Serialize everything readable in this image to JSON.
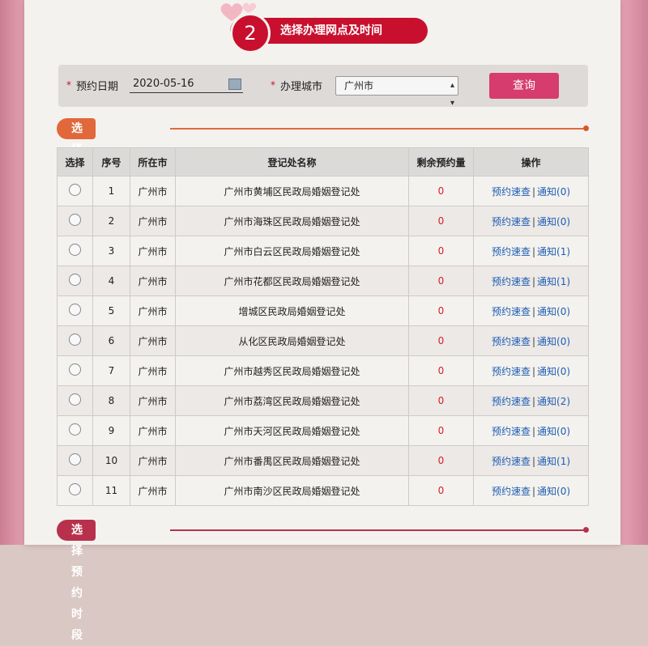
{
  "step": {
    "number": "2",
    "title": "选择办理网点及时间"
  },
  "search": {
    "date_label": "预约日期",
    "date_value": "2020-05-16",
    "city_label": "办理城市",
    "city_value": "广州市",
    "query_label": "查询"
  },
  "section_office": "选择办理网点",
  "section_time": "选择预约时段",
  "table": {
    "headers": [
      "选择",
      "序号",
      "所在市",
      "登记处名称",
      "剩余预约量",
      "操作"
    ],
    "rows": [
      {
        "no": "1",
        "city": "广州市",
        "name": "广州市黄埔区民政局婚姻登记处",
        "remain": "0",
        "query": "预约速查",
        "notify": "通知(0)"
      },
      {
        "no": "2",
        "city": "广州市",
        "name": "广州市海珠区民政局婚姻登记处",
        "remain": "0",
        "query": "预约速查",
        "notify": "通知(0)"
      },
      {
        "no": "3",
        "city": "广州市",
        "name": "广州市白云区民政局婚姻登记处",
        "remain": "0",
        "query": "预约速查",
        "notify": "通知(1)"
      },
      {
        "no": "4",
        "city": "广州市",
        "name": "广州市花都区民政局婚姻登记处",
        "remain": "0",
        "query": "预约速查",
        "notify": "通知(1)"
      },
      {
        "no": "5",
        "city": "广州市",
        "name": "增城区民政局婚姻登记处",
        "remain": "0",
        "query": "预约速查",
        "notify": "通知(0)"
      },
      {
        "no": "6",
        "city": "广州市",
        "name": "从化区民政局婚姻登记处",
        "remain": "0",
        "query": "预约速查",
        "notify": "通知(0)"
      },
      {
        "no": "7",
        "city": "广州市",
        "name": "广州市越秀区民政局婚姻登记处",
        "remain": "0",
        "query": "预约速查",
        "notify": "通知(0)"
      },
      {
        "no": "8",
        "city": "广州市",
        "name": "广州市荔湾区民政局婚姻登记处",
        "remain": "0",
        "query": "预约速查",
        "notify": "通知(2)"
      },
      {
        "no": "9",
        "city": "广州市",
        "name": "广州市天河区民政局婚姻登记处",
        "remain": "0",
        "query": "预约速查",
        "notify": "通知(0)"
      },
      {
        "no": "10",
        "city": "广州市",
        "name": "广州市番禺区民政局婚姻登记处",
        "remain": "0",
        "query": "预约速查",
        "notify": "通知(1)"
      },
      {
        "no": "11",
        "city": "广州市",
        "name": "广州市南沙区民政局婚姻登记处",
        "remain": "0",
        "query": "预约速查",
        "notify": "通知(0)"
      }
    ]
  },
  "colors": {
    "brand_red": "#c8102e",
    "query_button": "#d63c6e",
    "section_office_pill": "#e0683a",
    "section_time_pill": "#b8314c",
    "link_blue": "#1e5db3"
  }
}
